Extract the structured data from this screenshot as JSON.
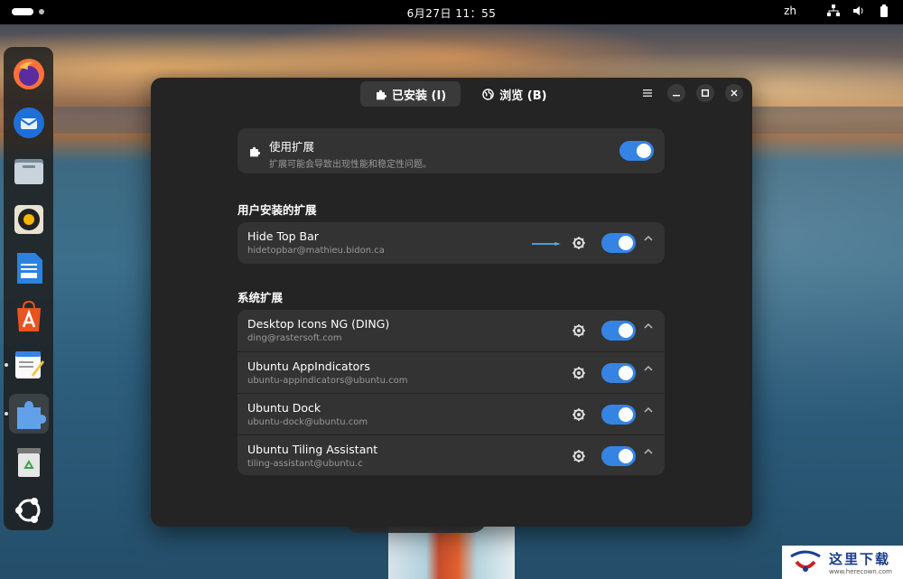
{
  "topbar": {
    "clock": "6月27日 11：55",
    "lang": "zh"
  },
  "dock": {
    "items": [
      {
        "name": "firefox",
        "icon": "firefox-icon"
      },
      {
        "name": "thunderbird",
        "icon": "thunderbird-icon"
      },
      {
        "name": "files",
        "icon": "files-icon"
      },
      {
        "name": "rhythmbox",
        "icon": "rhythmbox-icon"
      },
      {
        "name": "libreoffice-writer",
        "icon": "writer-icon"
      },
      {
        "name": "app-center",
        "icon": "app-center-icon"
      },
      {
        "name": "text-editor",
        "icon": "text-editor-icon"
      },
      {
        "name": "extensions",
        "icon": "puzzle-icon",
        "active": true
      },
      {
        "name": "trash",
        "icon": "trash-icon"
      },
      {
        "name": "show-apps",
        "icon": "ubuntu-icon"
      }
    ]
  },
  "window": {
    "tabs": [
      {
        "label": "已安装 (I)",
        "icon": "puzzle-icon",
        "selected": true
      },
      {
        "label": "浏览 (B)",
        "icon": "globe-icon",
        "selected": false
      }
    ],
    "master": {
      "title": "使用扩展",
      "subtitle": "扩展可能会导致出现性能和稳定性问题。",
      "enabled": true
    },
    "user_section_title": "用户安装的扩展",
    "user_extensions": [
      {
        "name": "Hide Top Bar",
        "uuid": "hidetopbar@mathieu.bidon.ca",
        "enabled": true
      }
    ],
    "system_section_title": "系统扩展",
    "system_extensions": [
      {
        "name": "Desktop Icons NG (DING)",
        "uuid": "ding@rastersoft.com",
        "enabled": true
      },
      {
        "name": "Ubuntu AppIndicators",
        "uuid": "ubuntu-appindicators@ubuntu.com",
        "enabled": true
      },
      {
        "name": "Ubuntu Dock",
        "uuid": "ubuntu-dock@ubuntu.com",
        "enabled": true
      },
      {
        "name": "Ubuntu Tiling Assistant",
        "uuid": "tiling-assistant@ubuntu.c",
        "enabled": true
      }
    ]
  },
  "watermark": {
    "cn": "这里下载",
    "url": "www.herecown.com"
  },
  "colors": {
    "accent": "#3584e4",
    "window_bg": "#242424",
    "card_bg": "#333333"
  }
}
